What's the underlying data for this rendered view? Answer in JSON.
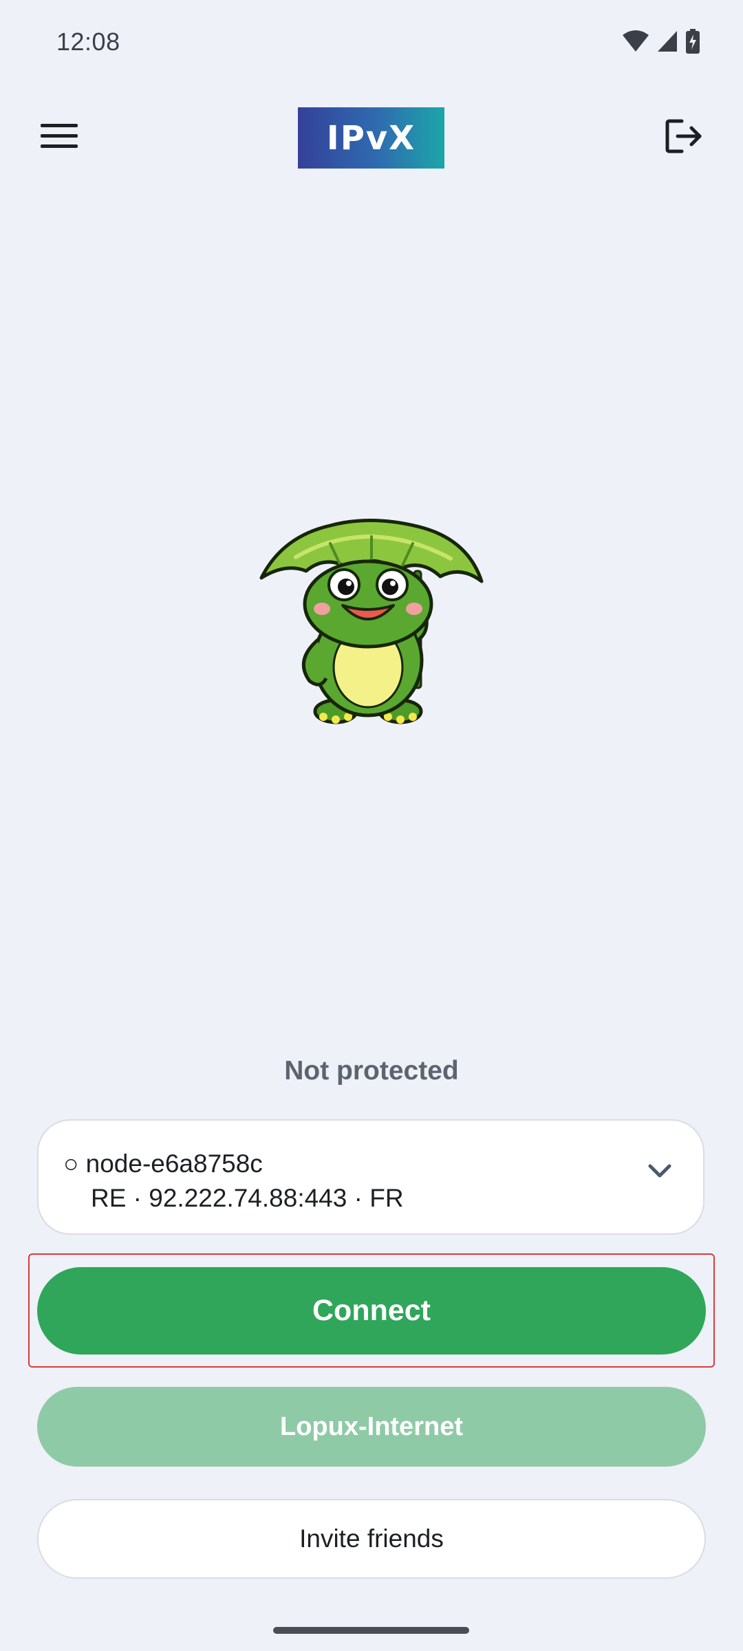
{
  "status_bar": {
    "time": "12:08",
    "icons": [
      "wifi-icon",
      "signal-icon",
      "battery-charging-icon"
    ]
  },
  "header": {
    "logo_text": "IPvX",
    "menu_icon": "hamburger-menu-icon",
    "logout_icon": "logout-icon"
  },
  "mascot": {
    "icon": "frog-with-leaf-umbrella-mascot"
  },
  "connection": {
    "status": "Not protected",
    "server": {
      "line1": "○ node-e6a8758c",
      "line2": "RE · 92.222.74.88:443 · FR"
    }
  },
  "buttons": {
    "connect": "Connect",
    "secondary": "Lopux-Internet",
    "invite": "Invite friends"
  },
  "colors": {
    "background": "#eef1f8",
    "primary_green": "#2fa65a",
    "disabled_green": "#8fcaa6",
    "focus_outline": "#d93a3a"
  }
}
